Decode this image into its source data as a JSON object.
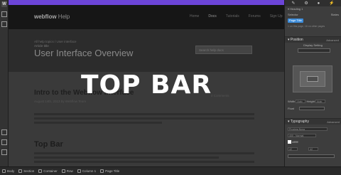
{
  "left_toolbar": {
    "logo": "W"
  },
  "site": {
    "logo": "webflow",
    "logo_suffix": "Help",
    "nav": [
      "Home",
      "Docs",
      "Tutorials",
      "Forums",
      "Sign Up"
    ],
    "active_nav": "Docs",
    "breadcrumb": "All help topics / User interface",
    "hero_label": "Article title",
    "hero_title": "User Interface Overview",
    "search_placeholder": "Search help docs"
  },
  "article": {
    "title": "Intro to the Webflow Interface",
    "meta": "August 14th, 2013   by Webflow Team",
    "comments": "0 Comments",
    "section_title": "Top Bar"
  },
  "overlay_label": "TOP BAR",
  "panel": {
    "heading": "Heading 1",
    "selector_label": "Selector",
    "states_label": "States",
    "chip": "Page Title",
    "on_page": "1 on this page, 16 on other pages",
    "position_header": "Position",
    "display_label": "Display Setting",
    "typography_header": "Typography",
    "advanced": "Advanced",
    "width_label": "Width",
    "width_value": "Auto",
    "height_label": "Height",
    "height_value": "Auto",
    "float_label": "Float",
    "font": "Proxima Nova",
    "weight": "400 - Normal",
    "color_label": "#ffffff",
    "size_value": "42",
    "line_value": "42"
  },
  "bottom_bar": [
    "Body",
    "Section",
    "Container",
    "Row",
    "Column 1",
    "Page Title"
  ],
  "colors": {
    "accent": "#6c45d8",
    "chip": "#3b8cdb"
  }
}
